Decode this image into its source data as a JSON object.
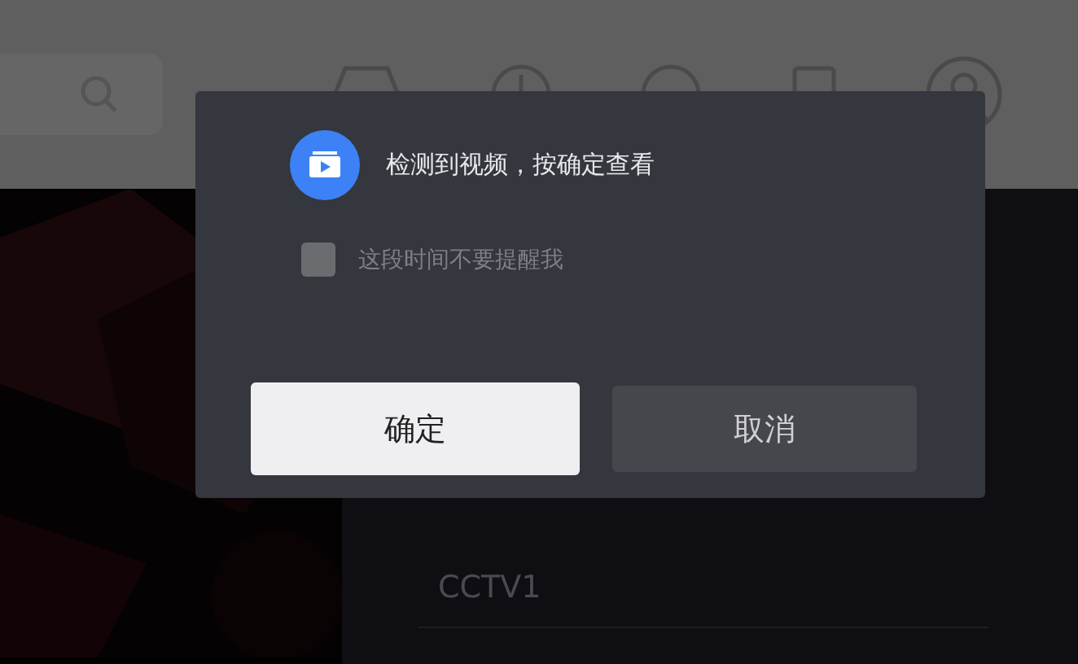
{
  "dialog": {
    "message": "检测到视频，按确定查看",
    "checkbox": {
      "label": "这段时间不要提醒我",
      "checked": false
    },
    "buttons": [
      {
        "label": "确定",
        "kind": "primary"
      },
      {
        "label": "取消",
        "kind": "secondary"
      }
    ]
  },
  "channels": [
    {
      "label": "CCTV1"
    }
  ]
}
